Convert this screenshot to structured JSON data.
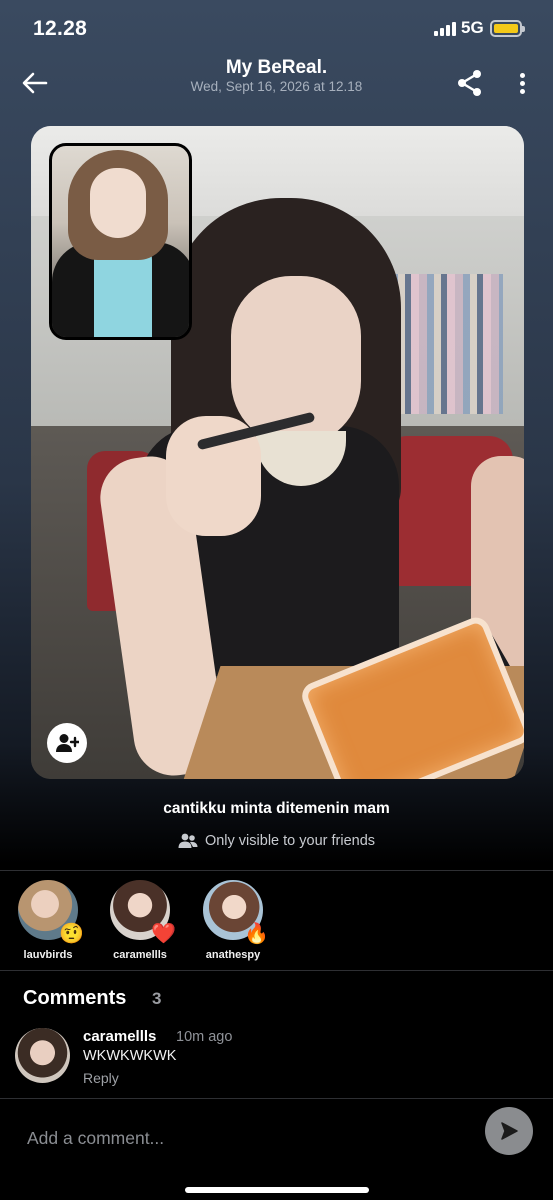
{
  "status_bar": {
    "time": "12.28",
    "network": "5G",
    "battery_color": "#f4c918",
    "signal_bars": 4
  },
  "header": {
    "title": "My BeReal.",
    "subtitle": "Wed, Sept 16, 2026 at 12.18",
    "back_icon": "arrow-left-icon",
    "share_icon": "share-icon",
    "more_icon": "more-vertical-icon"
  },
  "post": {
    "main_photo": "rear-camera-photo",
    "inset_photo": "front-camera-selfie",
    "add_friend_icon": "user-plus-icon",
    "caption": "cantikku minta ditemenin mam",
    "visibility_text": "Only visible to your friends",
    "visibility_icon": "friends-icon"
  },
  "reactions": [
    {
      "username": "lauvbirds",
      "emoji": "🤨"
    },
    {
      "username": "caramellls",
      "emoji": "❤️"
    },
    {
      "username": "anathespy",
      "emoji": "🔥"
    }
  ],
  "comments": {
    "heading": "Comments",
    "count": "3",
    "items": [
      {
        "username": "caramellls",
        "time": "10m ago",
        "text": "WKWKWKWK",
        "reply_label": "Reply"
      }
    ]
  },
  "composer": {
    "placeholder": "Add a comment...",
    "send_icon": "send-arrow-icon"
  }
}
